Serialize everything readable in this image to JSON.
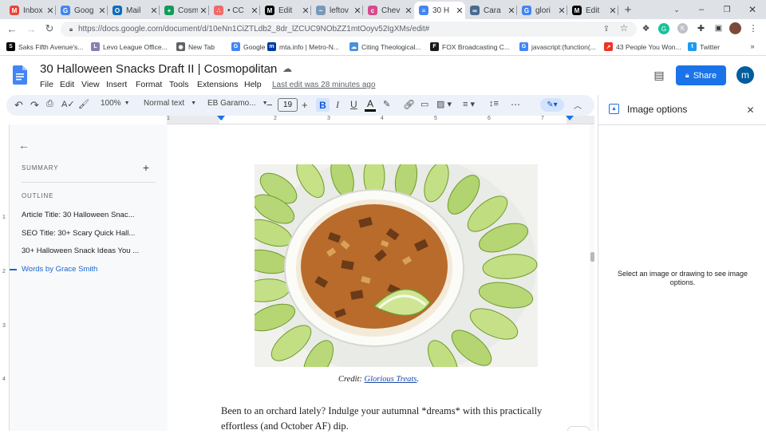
{
  "browser": {
    "tabs": [
      {
        "label": "Inbox",
        "icon": "gmail-icon",
        "color": "#ea4335",
        "glyph": "M"
      },
      {
        "label": "Goog",
        "icon": "google-workspace-icon",
        "color": "#4285f4",
        "glyph": "G"
      },
      {
        "label": "Mail",
        "icon": "outlook-icon",
        "color": "#0f6cbd",
        "glyph": "O"
      },
      {
        "label": "Cosm",
        "icon": "sheets-icon",
        "color": "#0f9d58",
        "glyph": "+"
      },
      {
        "label": "• CC",
        "icon": "asana-icon",
        "color": "#f06a6a",
        "glyph": "∴"
      },
      {
        "label": "Edit",
        "icon": "medium-icon",
        "color": "#000000",
        "glyph": "M"
      },
      {
        "label": "leftov",
        "icon": "fish-icon",
        "color": "#7a99b8",
        "glyph": "~"
      },
      {
        "label": "Chev",
        "icon": "chevy-icon",
        "color": "#d44a8c",
        "glyph": "c"
      },
      {
        "label": "30 H",
        "icon": "docs-icon",
        "color": "#4285f4",
        "glyph": "≡",
        "active": true
      },
      {
        "label": "Cara",
        "icon": "link-icon",
        "color": "#486c8f",
        "glyph": "∞"
      },
      {
        "label": "glori",
        "icon": "google-icon",
        "color": "#4285f4",
        "glyph": "G"
      },
      {
        "label": "Edit",
        "icon": "medium-icon",
        "color": "#000000",
        "glyph": "M"
      }
    ],
    "url": "https://docs.google.com/document/d/10eNn1CiZTLdb2_8dr_lZCUC9NObZZ1mtOoyv52IgXMs/edit#",
    "bookmarks": [
      {
        "label": "Saks Fifth Avenue's...",
        "icon": "saks-icon",
        "color": "#000000",
        "glyph": "S"
      },
      {
        "label": "Levo League Office...",
        "icon": "levo-icon",
        "color": "#8a7fb2",
        "glyph": "L"
      },
      {
        "label": "New Tab",
        "icon": "globe-icon",
        "color": "#5f6368",
        "glyph": "◉"
      },
      {
        "label": "Google",
        "icon": "google-icon",
        "color": "#4285f4",
        "glyph": "G"
      },
      {
        "label": "mta.info | Metro-N...",
        "icon": "mta-icon",
        "color": "#0039a6",
        "glyph": "m"
      },
      {
        "label": "Citing Theological...",
        "icon": "cloud-icon",
        "color": "#4a90d9",
        "glyph": "☁"
      },
      {
        "label": "FOX Broadcasting C...",
        "icon": "fox-icon",
        "color": "#1a1a1a",
        "glyph": "F"
      },
      {
        "label": "javascript:(function(...",
        "icon": "google-icon",
        "color": "#4285f4",
        "glyph": "G"
      },
      {
        "label": "43 People You Won...",
        "icon": "buzzfeed-icon",
        "color": "#e32",
        "glyph": "↗"
      },
      {
        "label": "Twitter",
        "icon": "twitter-icon",
        "color": "#1d9bf0",
        "glyph": "t"
      }
    ]
  },
  "doc": {
    "title": "30 Halloween Snacks Draft II | Cosmopolitan",
    "menus": [
      "File",
      "Edit",
      "View",
      "Insert",
      "Format",
      "Tools",
      "Extensions",
      "Help"
    ],
    "last_edit": "Last edit was 28 minutes ago",
    "share_label": "Share",
    "avatar_initial": "m"
  },
  "format": {
    "zoom": "100%",
    "style": "Normal text",
    "font": "EB Garamo...",
    "size": "19"
  },
  "ruler": {
    "h_ticks": [
      "1",
      "1",
      "2",
      "3",
      "4",
      "5",
      "6",
      "7"
    ],
    "v_ticks": [
      "1",
      "2",
      "3",
      "4"
    ]
  },
  "outline": {
    "summary_label": "SUMMARY",
    "outline_label": "OUTLINE",
    "items": [
      {
        "text": "Article Title: 30 Halloween Snac...",
        "active": false
      },
      {
        "text": "SEO Title: 30+ Scary Quick Hall...",
        "active": false
      },
      {
        "text": "30+ Halloween Snack Ideas You ...",
        "active": false
      },
      {
        "text": "Words by Grace Smith",
        "active": true
      }
    ]
  },
  "content": {
    "credit_prefix": "Credit: ",
    "credit_link": "Glorious Treats",
    "credit_suffix": ".",
    "paragraph": "Been to an orchard lately? Indulge your autumnal *dreams* with this practically effortless (and October AF) dip."
  },
  "side_panel": {
    "title": "Image options",
    "message": "Select an image or drawing to see image options."
  },
  "colors": {
    "accent": "#0b57d0",
    "share_bg": "#1a73e8",
    "avatar_bg": "#005e9e",
    "link": "#1a4aa8",
    "outline_active": "#1967d2"
  }
}
